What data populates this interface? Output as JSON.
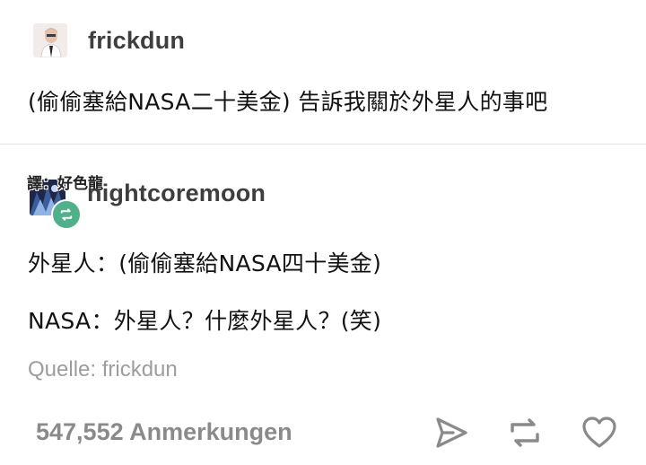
{
  "original_post": {
    "avatar_icon": "user-avatar-icon",
    "username": "frickdun",
    "text": "(偷偷塞給NASA二十美金) 告訴我關於外星人的事吧"
  },
  "reblog": {
    "avatar_icon": "user-avatar-icon",
    "badge_icon": "reblog-icon",
    "badge_color": "#4fb08a",
    "translator_note": "譯：好色龍",
    "username": "nightcoremoon",
    "lines": [
      "外星人：(偷偷塞給NASA四十美金)",
      "NASA：外星人？什麼外星人？(笑)"
    ]
  },
  "source": "Quelle: frickdun",
  "footer": {
    "notes": "547,552 Anmerkungen",
    "actions": [
      "share-icon",
      "reblog-icon",
      "like-icon"
    ]
  }
}
